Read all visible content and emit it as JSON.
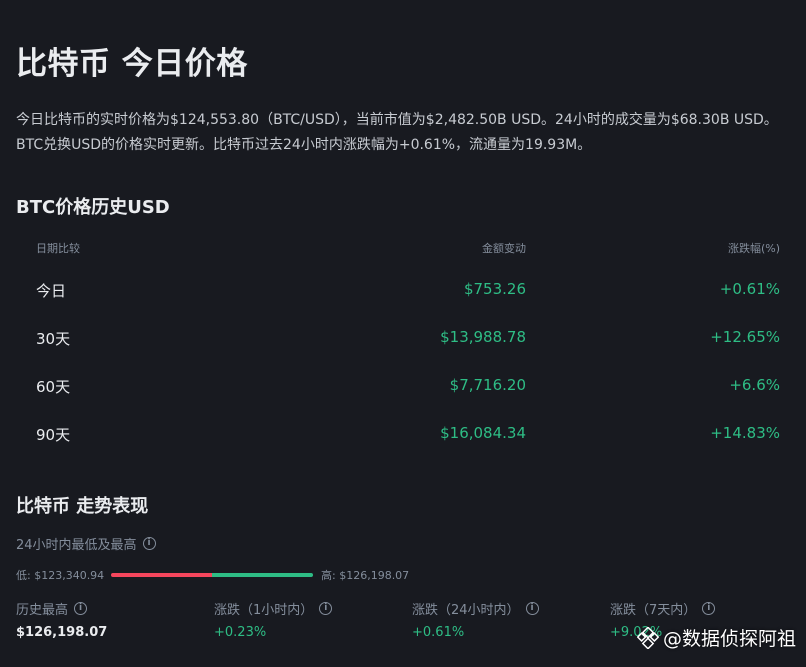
{
  "page": {
    "title": "比特币 今日价格",
    "intro": "今日比特币的实时价格为$124,553.80（BTC/USD），当前市值为$2,482.50B USD。24小时的成交量为$68.30B USD。BTC兑换USD的价格实时更新。比特币过去24小时内涨跌幅为+0.61%，流通量为19.93M。"
  },
  "history": {
    "title": "BTC价格历史USD",
    "headers": {
      "period": "日期比较",
      "amount": "金额变动",
      "pct": "涨跌幅(%)"
    },
    "rows": [
      {
        "period": "今日",
        "amount": "$753.26",
        "pct": "+0.61%"
      },
      {
        "period": "30天",
        "amount": "$13,988.78",
        "pct": "+12.65%"
      },
      {
        "period": "60天",
        "amount": "$7,716.20",
        "pct": "+6.6%"
      },
      {
        "period": "90天",
        "amount": "$16,084.34",
        "pct": "+14.83%"
      }
    ]
  },
  "trend": {
    "title": "比特币 走势表现",
    "range_label": "24小时内最低及最高",
    "low_label": "低: $123,340.94",
    "high_label": "高: $126,198.07",
    "range_fraction_low": 0.5,
    "stats": [
      {
        "label": "历史最高",
        "value": "$126,198.07"
      },
      {
        "label": "涨跌（1小时内）",
        "value": "+0.23%"
      },
      {
        "label": "涨跌（24小时内）",
        "value": "+0.61%"
      },
      {
        "label": "涨跌（7天内）",
        "value": "+9.02%"
      }
    ]
  },
  "watermark": {
    "text": "@数据侦探阿祖"
  },
  "colors": {
    "up": "#2ebd85",
    "down": "#f6465d",
    "background": "#181a20"
  },
  "icons": {
    "info": "info-circle-icon",
    "watermark_logo": "binance-square-icon"
  }
}
